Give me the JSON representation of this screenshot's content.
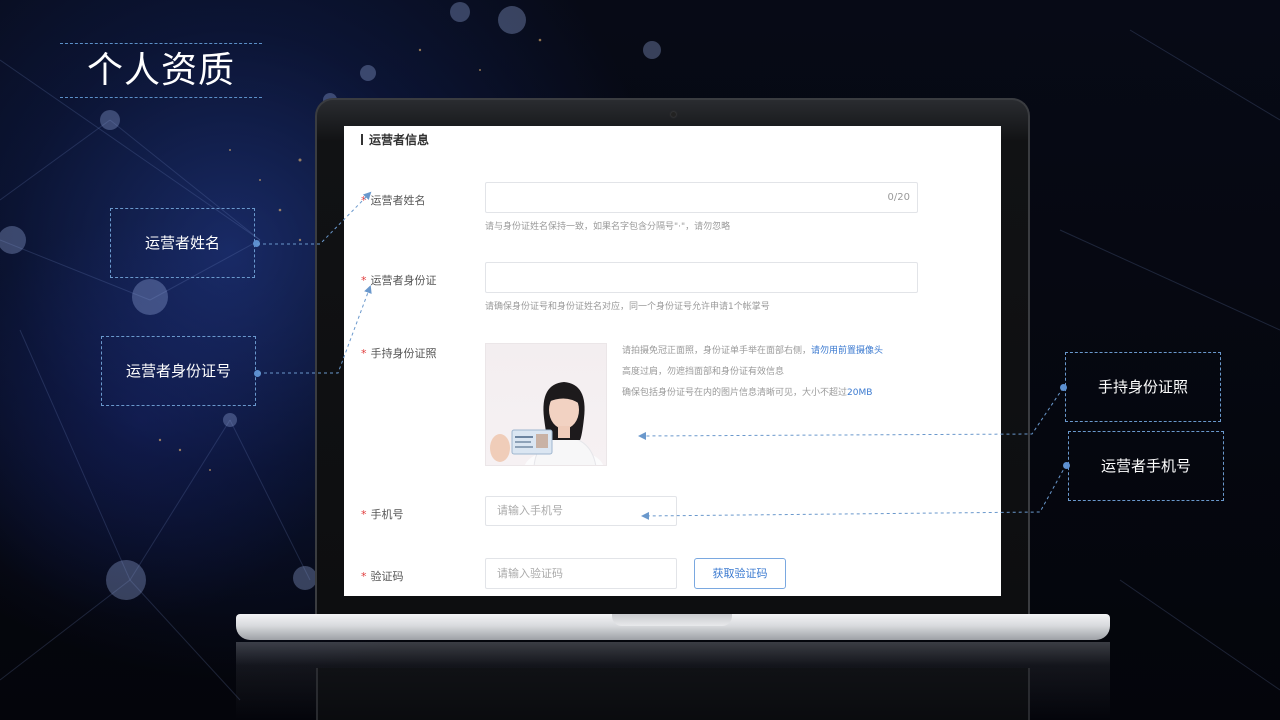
{
  "page": {
    "title": "个人资质"
  },
  "form": {
    "section_title": "运营者信息",
    "required_mark": "*",
    "name": {
      "label": "运营者姓名",
      "counter": "0/20",
      "hint": "请与身份证姓名保持一致，如果名字包含分隔号\"·\"，请勿忽略"
    },
    "id_card": {
      "label": "运营者身份证",
      "hint": "请确保身份证号和身份证姓名对应，同一个身份证号允许申请1个帐掌号"
    },
    "photo": {
      "label": "手持身份证照",
      "tip1_prefix": "请拍摄免冠正面照，身份证单手举在面部右侧，",
      "tip1_link": "请勿用前置摄像头",
      "tip2": "高度过肩，勿遮挡面部和身份证有效信息",
      "tip3_prefix": "确保包括身份证号在内的图片信息清晰可见，大小不超过",
      "tip3_size": "20MB"
    },
    "phone": {
      "label": "手机号",
      "placeholder": "请输入手机号"
    },
    "code": {
      "label": "验证码",
      "placeholder": "请输入验证码",
      "button": "获取验证码"
    }
  },
  "callouts": {
    "name": "运营者姓名",
    "id_card": "运营者身份证号",
    "photo": "手持身份证照",
    "phone": "运营者手机号"
  },
  "colors": {
    "accent": "#5c8fd0",
    "link": "#3b7ad0",
    "required": "#e03a3a"
  }
}
